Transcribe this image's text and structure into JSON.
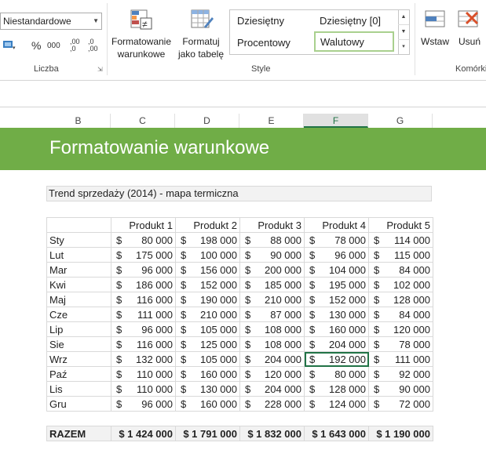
{
  "ribbon": {
    "number_format_value": "Niestandardowe",
    "percent_symbol": "%",
    "thousands_symbol": "000",
    "inc_decimal": ",00 ,0",
    "dec_decimal": ",0 ,00",
    "groups": {
      "number": "Liczba",
      "styles": "Style",
      "cells": "Komórki"
    },
    "conditional_formatting": "Formatowanie warunkowe",
    "format_as_table": "Formatuj jako tabelę",
    "cell_styles": [
      "Dziesiętny",
      "Dziesiętny [0]",
      "Procentowy",
      "Walutowy"
    ],
    "insert": "Wstaw",
    "delete": "Usuń"
  },
  "columns": [
    "B",
    "C",
    "D",
    "E",
    "F",
    "G"
  ],
  "banner_title": "Formatowanie warunkowe",
  "table_title": "Trend sprzedaży (2014) - mapa termiczna",
  "headers": [
    "Produkt 1",
    "Produkt 2",
    "Produkt 3",
    "Produkt 4",
    "Produkt 5"
  ],
  "currency": "$",
  "rows": [
    {
      "label": "Sty",
      "values": [
        "80 000",
        "198 000",
        "88 000",
        "78 000",
        "114 000"
      ]
    },
    {
      "label": "Lut",
      "values": [
        "175 000",
        "100 000",
        "90 000",
        "96 000",
        "115 000"
      ]
    },
    {
      "label": "Mar",
      "values": [
        "96 000",
        "156 000",
        "200 000",
        "104 000",
        "84 000"
      ]
    },
    {
      "label": "Kwi",
      "values": [
        "186 000",
        "152 000",
        "185 000",
        "195 000",
        "102 000"
      ]
    },
    {
      "label": "Maj",
      "values": [
        "116 000",
        "190 000",
        "210 000",
        "152 000",
        "128 000"
      ]
    },
    {
      "label": "Cze",
      "values": [
        "111 000",
        "210 000",
        "87 000",
        "130 000",
        "84 000"
      ]
    },
    {
      "label": "Lip",
      "values": [
        "96 000",
        "105 000",
        "108 000",
        "160 000",
        "120 000"
      ]
    },
    {
      "label": "Sie",
      "values": [
        "116 000",
        "125 000",
        "108 000",
        "204 000",
        "78 000"
      ]
    },
    {
      "label": "Wrz",
      "values": [
        "132 000",
        "105 000",
        "204 000",
        "192 000",
        "111 000"
      ]
    },
    {
      "label": "Paź",
      "values": [
        "110 000",
        "160 000",
        "120 000",
        "80 000",
        "92 000"
      ]
    },
    {
      "label": "Lis",
      "values": [
        "110 000",
        "130 000",
        "204 000",
        "128 000",
        "90 000"
      ]
    },
    {
      "label": "Gru",
      "values": [
        "96 000",
        "160 000",
        "228 000",
        "124 000",
        "72 000"
      ]
    }
  ],
  "total": {
    "label": "RAZEM",
    "values": [
      "$ 1 424 000",
      "$ 1 791 000",
      "$ 1 832 000",
      "$ 1 643 000",
      "$ 1 190 000"
    ]
  }
}
